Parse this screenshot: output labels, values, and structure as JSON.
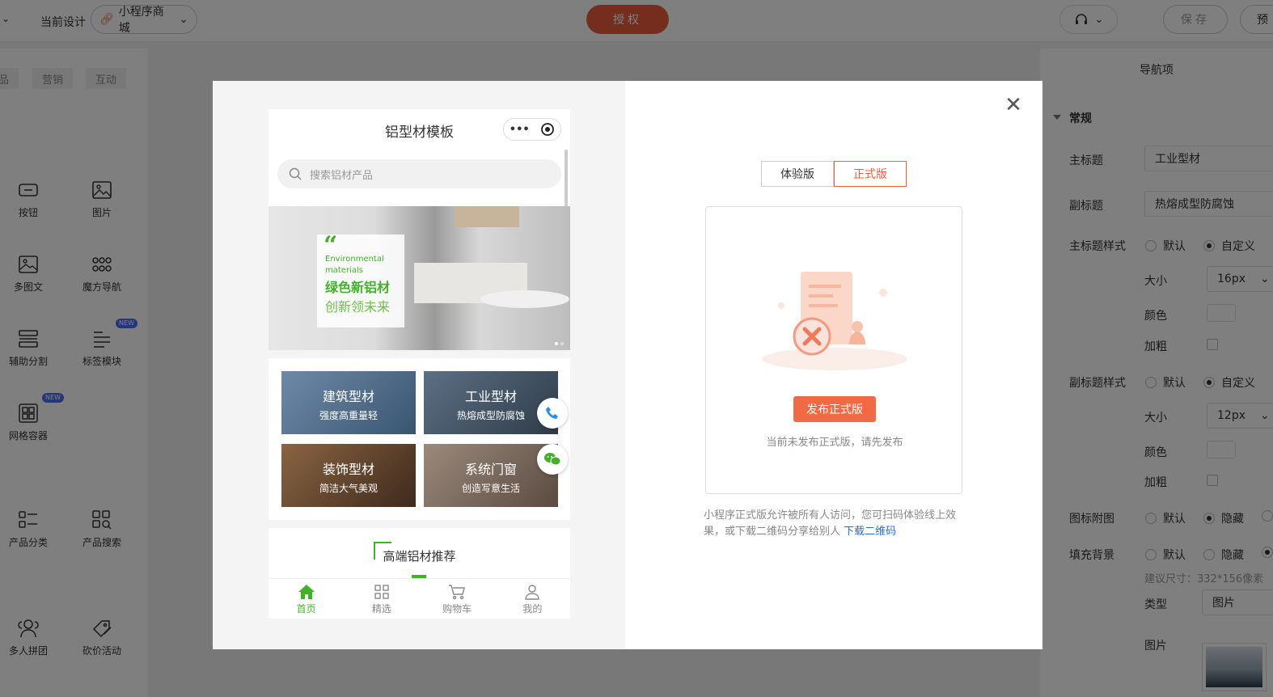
{
  "topbar": {
    "current_design_label": "当前设计",
    "app_select": "小程序商城",
    "auth_button": "授权",
    "save_button": "保存",
    "publish_button_partial": "预"
  },
  "left_panel": {
    "tabs": [
      "品",
      "营销",
      "互动"
    ],
    "widgets": [
      {
        "label": "按钮",
        "icon": "button-icon"
      },
      {
        "label": "图片",
        "icon": "image-icon"
      },
      {
        "label": "多图文",
        "icon": "multi-image-icon"
      },
      {
        "label": "魔方导航",
        "icon": "grid-nav-icon"
      },
      {
        "label": "辅助分割",
        "icon": "divider-icon"
      },
      {
        "label": "标签模块",
        "icon": "tag-module-icon",
        "badge": "NEW"
      },
      {
        "label": "网格容器",
        "icon": "grid-container-icon",
        "badge": "NEW"
      },
      {
        "label": "产品分类",
        "icon": "product-category-icon"
      },
      {
        "label": "产品搜索",
        "icon": "product-search-icon"
      },
      {
        "label": "多人拼团",
        "icon": "group-buy-icon"
      },
      {
        "label": "砍价活动",
        "icon": "bargain-icon"
      }
    ]
  },
  "right_panel": {
    "title": "导航项",
    "section": "常规",
    "main_title_label": "主标题",
    "main_title_value": "工业型材",
    "subtitle_label": "副标题",
    "subtitle_value": "热熔成型防腐蚀",
    "main_style_label": "主标题样式",
    "sub_style_label": "副标题样式",
    "opt_default": "默认",
    "opt_custom": "自定义",
    "opt_hide": "隐藏",
    "size_label": "大小",
    "main_size": "16px",
    "sub_size": "12px",
    "color_label": "颜色",
    "bold_label": "加粗",
    "icon_image_label": "图标附图",
    "fill_bg_label": "填充背景",
    "size_hint": "建议尺寸：332*156像素",
    "type_label": "类型",
    "type_value": "图片",
    "image_label": "图片"
  },
  "phone": {
    "title": "铝型材模板",
    "search_placeholder": "搜索铝材产品",
    "banner": {
      "quote": "“",
      "en_line1": "Environmental",
      "en_line2": "materials",
      "zh_line1": "绿色新铝材",
      "zh_line2": "创新领未来"
    },
    "tiles": [
      {
        "title": "建筑型材",
        "sub": "强度高重量轻",
        "color": "#4a6a8a"
      },
      {
        "title": "工业型材",
        "sub": "热熔成型防腐蚀",
        "color": "#3e4f60"
      },
      {
        "title": "装饰型材",
        "sub": "简洁大气美观",
        "color": "#6b4a32"
      },
      {
        "title": "系统门窗",
        "sub": "创造写意生活",
        "color": "#7a6a5e"
      }
    ],
    "section_title": "高端铝材推荐",
    "tabbar": [
      {
        "label": "首页",
        "icon": "home-icon"
      },
      {
        "label": "精选",
        "icon": "grid-icon"
      },
      {
        "label": "购物车",
        "icon": "cart-icon"
      },
      {
        "label": "我的",
        "icon": "user-icon"
      }
    ]
  },
  "publish": {
    "tab_trial": "体验版",
    "tab_release": "正式版",
    "publish_button": "发布正式版",
    "hint": "当前未发布正式版，请先发布",
    "note": "小程序正式版允许被所有人访问，您可扫码体验线上效果，或下载二维码分享给别人",
    "download_link": "下载二维码"
  },
  "colors": {
    "accent": "#ea5b3a",
    "green": "#43b02a",
    "link": "#2b6fd6"
  }
}
